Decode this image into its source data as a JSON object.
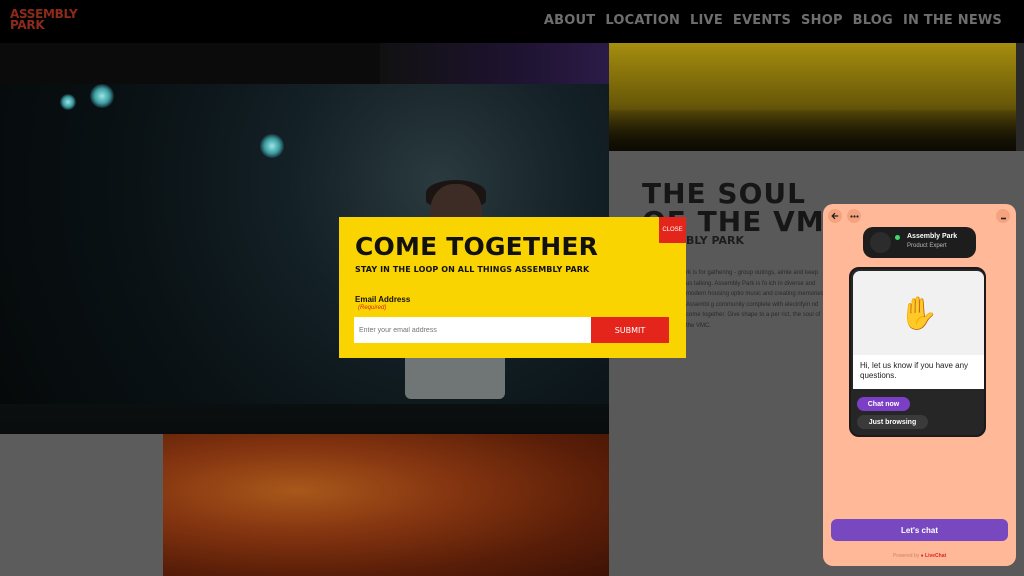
{
  "site": {
    "logo_line1": "ASSEMBLY",
    "logo_line2": "PARK",
    "nav": [
      "ABOUT",
      "LOCATION",
      "LIVE",
      "EVENTS",
      "SHOP",
      "BLOG",
      "IN THE NEWS"
    ]
  },
  "section": {
    "title_line1": "THE SOUL",
    "title_line2": "OF THE VMC",
    "subtitle": "BLY PARK",
    "body": "rk is for gathering - group outings, aimle and keep us talking. Assembly Park is fo ich in diverse and modern housing optio music and creating memories. Assembl g community complete with electrifyin nd come together. Give shape to a per rict, the soul of the VMC."
  },
  "modal": {
    "close_label": "CLOSE",
    "title": "COME TOGETHER",
    "subtitle": "STAY IN THE LOOP ON ALL THINGS ASSEMBLY PARK",
    "email_label": "Email Address",
    "required_label": "(Required)",
    "email_placeholder": "Enter your email address",
    "submit_label": "SUBMIT"
  },
  "chat": {
    "agent_name": "Assembly Park",
    "agent_role": "Product Expert",
    "greeting": "Hi, let us know if you have any questions.",
    "chat_now": "Chat now",
    "just_browsing": "Just browsing",
    "lets_chat": "Let's chat",
    "powered_by": "Powered by",
    "powered_brand": "LiveChat",
    "icons": [
      "back-arrow-icon",
      "more-options-icon",
      "minimize-icon",
      "wave-hand-icon",
      "livechat-logo-icon"
    ]
  },
  "colors": {
    "modal_bg": "#f9d400",
    "accent_red": "#e4251b",
    "chat_bg": "#ffb998",
    "chat_purple": "#7848c0"
  }
}
